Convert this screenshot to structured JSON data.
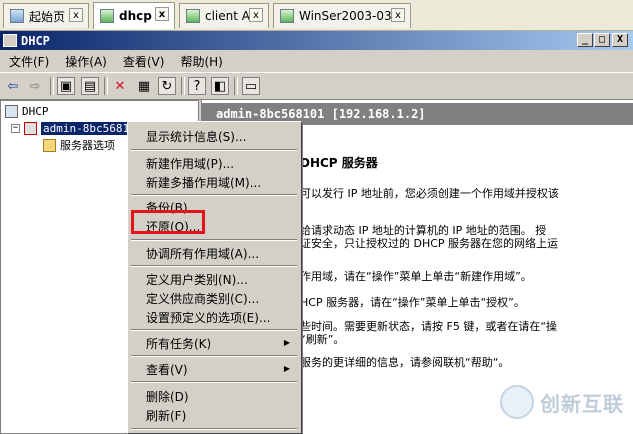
{
  "tabs": [
    {
      "label": "起始页",
      "close": "x"
    },
    {
      "label": "dhcp",
      "close": "x"
    },
    {
      "label": "client A",
      "close": "x"
    },
    {
      "label": "WinSer2003-03",
      "close": "x"
    }
  ],
  "window": {
    "title": "DHCP",
    "min": "_",
    "max": "□",
    "close": "X"
  },
  "menu": [
    "文件(F)",
    "操作(A)",
    "查看(V)",
    "帮助(H)"
  ],
  "toolbar_icons": [
    "back-arrow-icon",
    "forward-arrow-icon",
    "up-folder-icon",
    "show-tree-icon",
    "delete-icon",
    "properties-icon",
    "refresh-icon",
    "help-icon",
    "export-icon",
    "console-icon"
  ],
  "tree": {
    "root": "DHCP",
    "server": "admin-8bc56810",
    "server_options": "服务器选项"
  },
  "right": {
    "header": "admin-8bc568101 [192.168.1.2]",
    "title": "DHCP 服务器",
    "lines": [
      "可以发行 IP 地址前，您必须创建一个作用域并授权该",
      "给请求动态 IP 地址的计算机的 IP 地址的范围。 授",
      "证安全，只让授权过的 DHCP 服务器在您的网络上运",
      "作用域，请在“操作”菜单上单击“新建作用域”。",
      "HCP 服务器，请在“操作”菜单上单击“授权”。",
      "些时间。需要更新状态，请按 F5 键，或者在请在“操",
      "“刷新”。",
      "服务的更详细的信息，请参阅联机“帮助“。"
    ]
  },
  "context_menu": {
    "items": [
      "显示统计信息(S)...",
      "新建作用域(P)...",
      "新建多播作用域(M)...",
      "备份(B)...",
      "还原(O)...",
      "协调所有作用域(A)...",
      "定义用户类别(N)...",
      "定义供应商类别(C)...",
      "设置预定义的选项(E)...",
      "所有任务(K)",
      "查看(V)",
      "删除(D)",
      "刷新(F)"
    ]
  },
  "watermark": "创新互联",
  "colors": {
    "highlight_box": "#e3121b",
    "titlebar": "#0a246a"
  }
}
